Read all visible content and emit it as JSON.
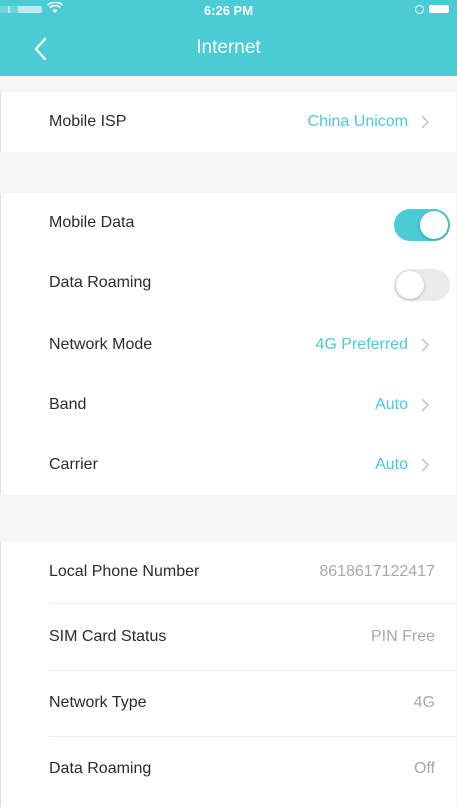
{
  "status_bar": {
    "time": "6:26 PM"
  },
  "nav": {
    "title": "Internet",
    "back_icon": "chevron-left-icon"
  },
  "isp_section": {
    "label": "Mobile ISP",
    "value": "China Unicom"
  },
  "settings_section": {
    "mobile_data": {
      "label": "Mobile Data",
      "on": true
    },
    "data_roaming": {
      "label": "Data Roaming",
      "on": false
    },
    "network_mode": {
      "label": "Network Mode",
      "value": "4G Preferred"
    },
    "band": {
      "label": "Band",
      "value": "Auto"
    },
    "carrier": {
      "label": "Carrier",
      "value": "Auto"
    }
  },
  "info_section": {
    "local_phone_number": {
      "label": "Local Phone Number",
      "value": "8618617122417"
    },
    "sim_card_status": {
      "label": "SIM Card Status",
      "value": "PIN Free"
    },
    "network_type": {
      "label": "Network Type",
      "value": "4G"
    },
    "data_roaming": {
      "label": "Data Roaming",
      "value": "Off"
    }
  },
  "colors": {
    "accent": "#4acbd6",
    "background": "#f6f6f6",
    "secondary_text": "#a8a8a8"
  }
}
